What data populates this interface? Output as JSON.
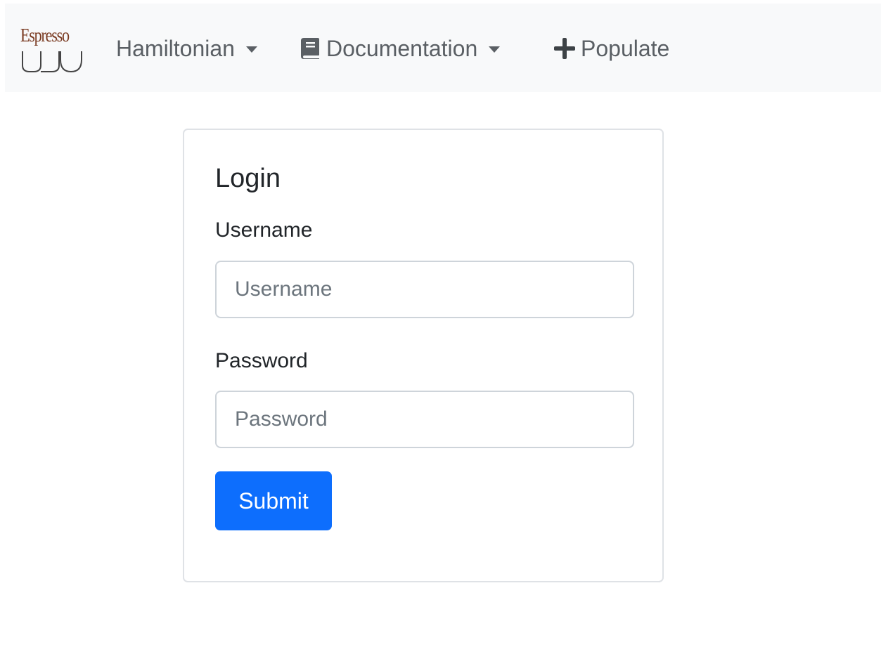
{
  "navbar": {
    "brand_text": "Espresso",
    "items": [
      {
        "label": "Hamiltonian",
        "icon": "caret-down-icon"
      },
      {
        "label": "Documentation",
        "icon": "book-icon"
      },
      {
        "label": "Populate",
        "icon": "plus-icon"
      }
    ],
    "background_color": "#f8f9fa"
  },
  "login": {
    "title": "Login",
    "username_label": "Username",
    "username_placeholder": "Username",
    "username_value": "",
    "password_label": "Password",
    "password_placeholder": "Password",
    "password_value": "",
    "submit_label": "Submit"
  },
  "colors": {
    "primary": "#0d6efd",
    "brand": "#7a3b22",
    "nav_text": "#5a5f64"
  }
}
